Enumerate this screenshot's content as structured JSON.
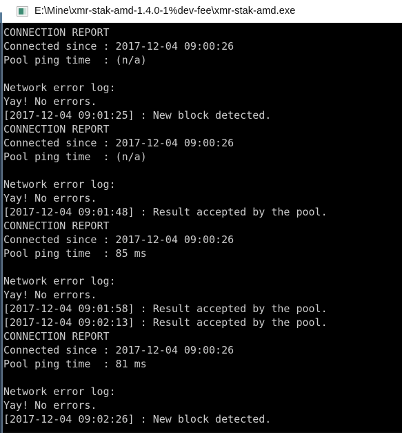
{
  "window": {
    "title": "E:\\Mine\\xmr-stak-amd-1.4.0-1%dev-fee\\xmr-stak-amd.exe",
    "icon": "console-app-icon",
    "titlebar_bg": "#ffffff",
    "titlebar_fg": "#0c0c0c",
    "console_bg": "#000000",
    "console_fg": "#cccccc"
  },
  "console": {
    "lines": [
      "CONNECTION REPORT",
      "Connected since : 2017-12-04 09:00:26",
      "Pool ping time  : (n/a)",
      "",
      "Network error log:",
      "Yay! No errors.",
      "[2017-12-04 09:01:25] : New block detected.",
      "CONNECTION REPORT",
      "Connected since : 2017-12-04 09:00:26",
      "Pool ping time  : (n/a)",
      "",
      "Network error log:",
      "Yay! No errors.",
      "[2017-12-04 09:01:48] : Result accepted by the pool.",
      "CONNECTION REPORT",
      "Connected since : 2017-12-04 09:00:26",
      "Pool ping time  : 85 ms",
      "",
      "Network error log:",
      "Yay! No errors.",
      "[2017-12-04 09:01:58] : Result accepted by the pool.",
      "[2017-12-04 09:02:13] : Result accepted by the pool.",
      "CONNECTION REPORT",
      "Connected since : 2017-12-04 09:00:26",
      "Pool ping time  : 81 ms",
      "",
      "Network error log:",
      "Yay! No errors.",
      "[2017-12-04 09:02:26] : New block detected."
    ]
  }
}
